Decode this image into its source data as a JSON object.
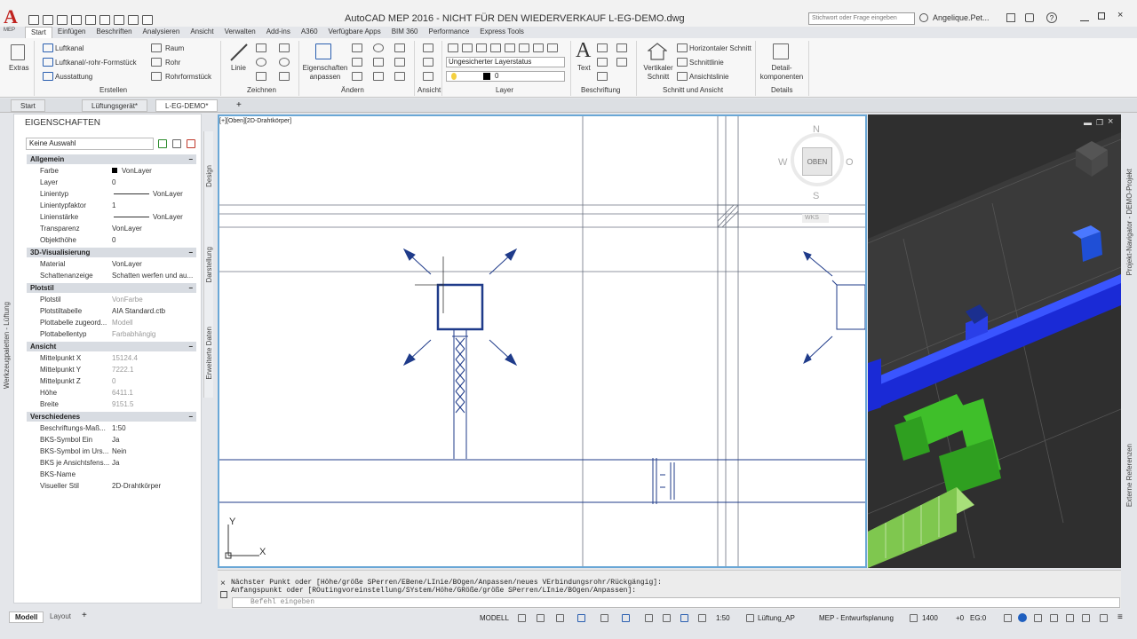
{
  "app": {
    "title": "AutoCAD MEP 2016 - NICHT FÜR DEN WIEDERVERKAUF    L-EG-DEMO.dwg",
    "logo_letter": "A",
    "logo_sub": "MEP",
    "search_placeholder": "Stichwort oder Frage eingeben",
    "user": "Angelique.Pet..."
  },
  "ribbon_tabs": [
    "Start",
    "Einfügen",
    "Beschriften",
    "Analysieren",
    "Ansicht",
    "Verwalten",
    "Add-ins",
    "A360",
    "Verfügbare Apps",
    "BIM 360",
    "Performance",
    "Express Tools"
  ],
  "ribbon": {
    "extras": "Extras",
    "erstellen": {
      "items": [
        "Luftkanal",
        "Luftkanal/-rohr-Formstück",
        "Ausstattung",
        "Raum",
        "Rohr",
        "Rohrformstück"
      ],
      "title": "Erstellen"
    },
    "zeichnen": {
      "linie": "Linie",
      "title": "Zeichnen"
    },
    "aendern": {
      "eig": "Eigenschaften anpassen",
      "title": "Ändern"
    },
    "ansicht": {
      "title": "Ansicht"
    },
    "layer": {
      "status": "Ungesicherter Layerstatus",
      "current": "0",
      "title": "Layer"
    },
    "beschriftung": {
      "text": "Text",
      "title": "Beschriftung"
    },
    "schnitt": {
      "vertikal": "Vertikaler Schnitt",
      "items": [
        "Horizontaler Schnitt",
        "Schnittlinie",
        "Ansichtslinie"
      ],
      "title": "Schnitt und Ansicht"
    },
    "details": {
      "btn": "Detail-komponenten",
      "title": "Details"
    }
  },
  "doc_tabs": [
    "Start",
    "Lüftungsgerät*",
    "L-EG-DEMO*"
  ],
  "properties": {
    "title": "EIGENSCHAFTEN",
    "selection": "Keine Auswahl",
    "sections": [
      {
        "name": "Allgemein",
        "rows": [
          [
            "Farbe",
            "VonLayer"
          ],
          [
            "Layer",
            "0"
          ],
          [
            "Linientyp",
            "VonLayer"
          ],
          [
            "Linientypfaktor",
            "1"
          ],
          [
            "Linienstärke",
            "VonLayer"
          ],
          [
            "Transparenz",
            "VonLayer"
          ],
          [
            "Objekthöhe",
            "0"
          ]
        ]
      },
      {
        "name": "3D-Visualisierung",
        "rows": [
          [
            "Material",
            "VonLayer"
          ],
          [
            "Schattenanzeige",
            "Schatten werfen und au..."
          ]
        ]
      },
      {
        "name": "Plotstil",
        "rows": [
          [
            "Plotstil",
            "VonFarbe"
          ],
          [
            "Plotstiltabelle",
            "AIA Standard.ctb"
          ],
          [
            "Plottabelle zugeord...",
            "Modell"
          ],
          [
            "Plottabellentyp",
            "Farbabhängig"
          ]
        ]
      },
      {
        "name": "Ansicht",
        "rows": [
          [
            "Mittelpunkt X",
            "15124.4"
          ],
          [
            "Mittelpunkt Y",
            "7222.1"
          ],
          [
            "Mittelpunkt Z",
            "0"
          ],
          [
            "Höhe",
            "6411.1"
          ],
          [
            "Breite",
            "9151.5"
          ]
        ]
      },
      {
        "name": "Verschiedenes",
        "rows": [
          [
            "Beschriftungs-Maß...",
            "1:50"
          ],
          [
            "BKS-Symbol Ein",
            "Ja"
          ],
          [
            "BKS-Symbol im Urs...",
            "Nein"
          ],
          [
            "BKS je Ansichtsfens...",
            "Ja"
          ],
          [
            "BKS-Name",
            ""
          ],
          [
            "Visueller Stil",
            "2D-Drahtkörper"
          ]
        ]
      }
    ],
    "side_tabs": [
      "Design",
      "Darstellung",
      "Erweiterte Daten"
    ],
    "palette_label": "Werkzeugpaletten - Lüftung"
  },
  "viewport": {
    "label": "[+][Oben][2D-Drahtkörper]",
    "cube_top": "OBEN",
    "n": "N",
    "s": "S",
    "w": "W",
    "o": "O",
    "wks": "WKS",
    "x_axis": "X",
    "y_axis": "Y"
  },
  "right_tabs": [
    "Projekt-Navigator - DEMO-Projekt",
    "Externe Referenzen"
  ],
  "command": {
    "line1": "Nächster Punkt oder [Höhe/größe SPerren/EBene/LInie/BOgen/Anpassen/neues VErbindungsrohr/Rückgängig]:",
    "line2": "Anfangspunkt oder [ROutingvoreinstellung/SYstem/Höhe/GRöße/größe SPerren/LInie/BOgen/Anpassen]:",
    "placeholder": "Befehl eingeben"
  },
  "status": {
    "tabs": [
      "Modell",
      "Layout"
    ],
    "model": "MODELL",
    "scale": "1:50",
    "system": "Lüftung_AP",
    "config": "MEP - Entwurfsplanung",
    "value": "1400",
    "offset": "+0",
    "eg": "EG:0"
  }
}
